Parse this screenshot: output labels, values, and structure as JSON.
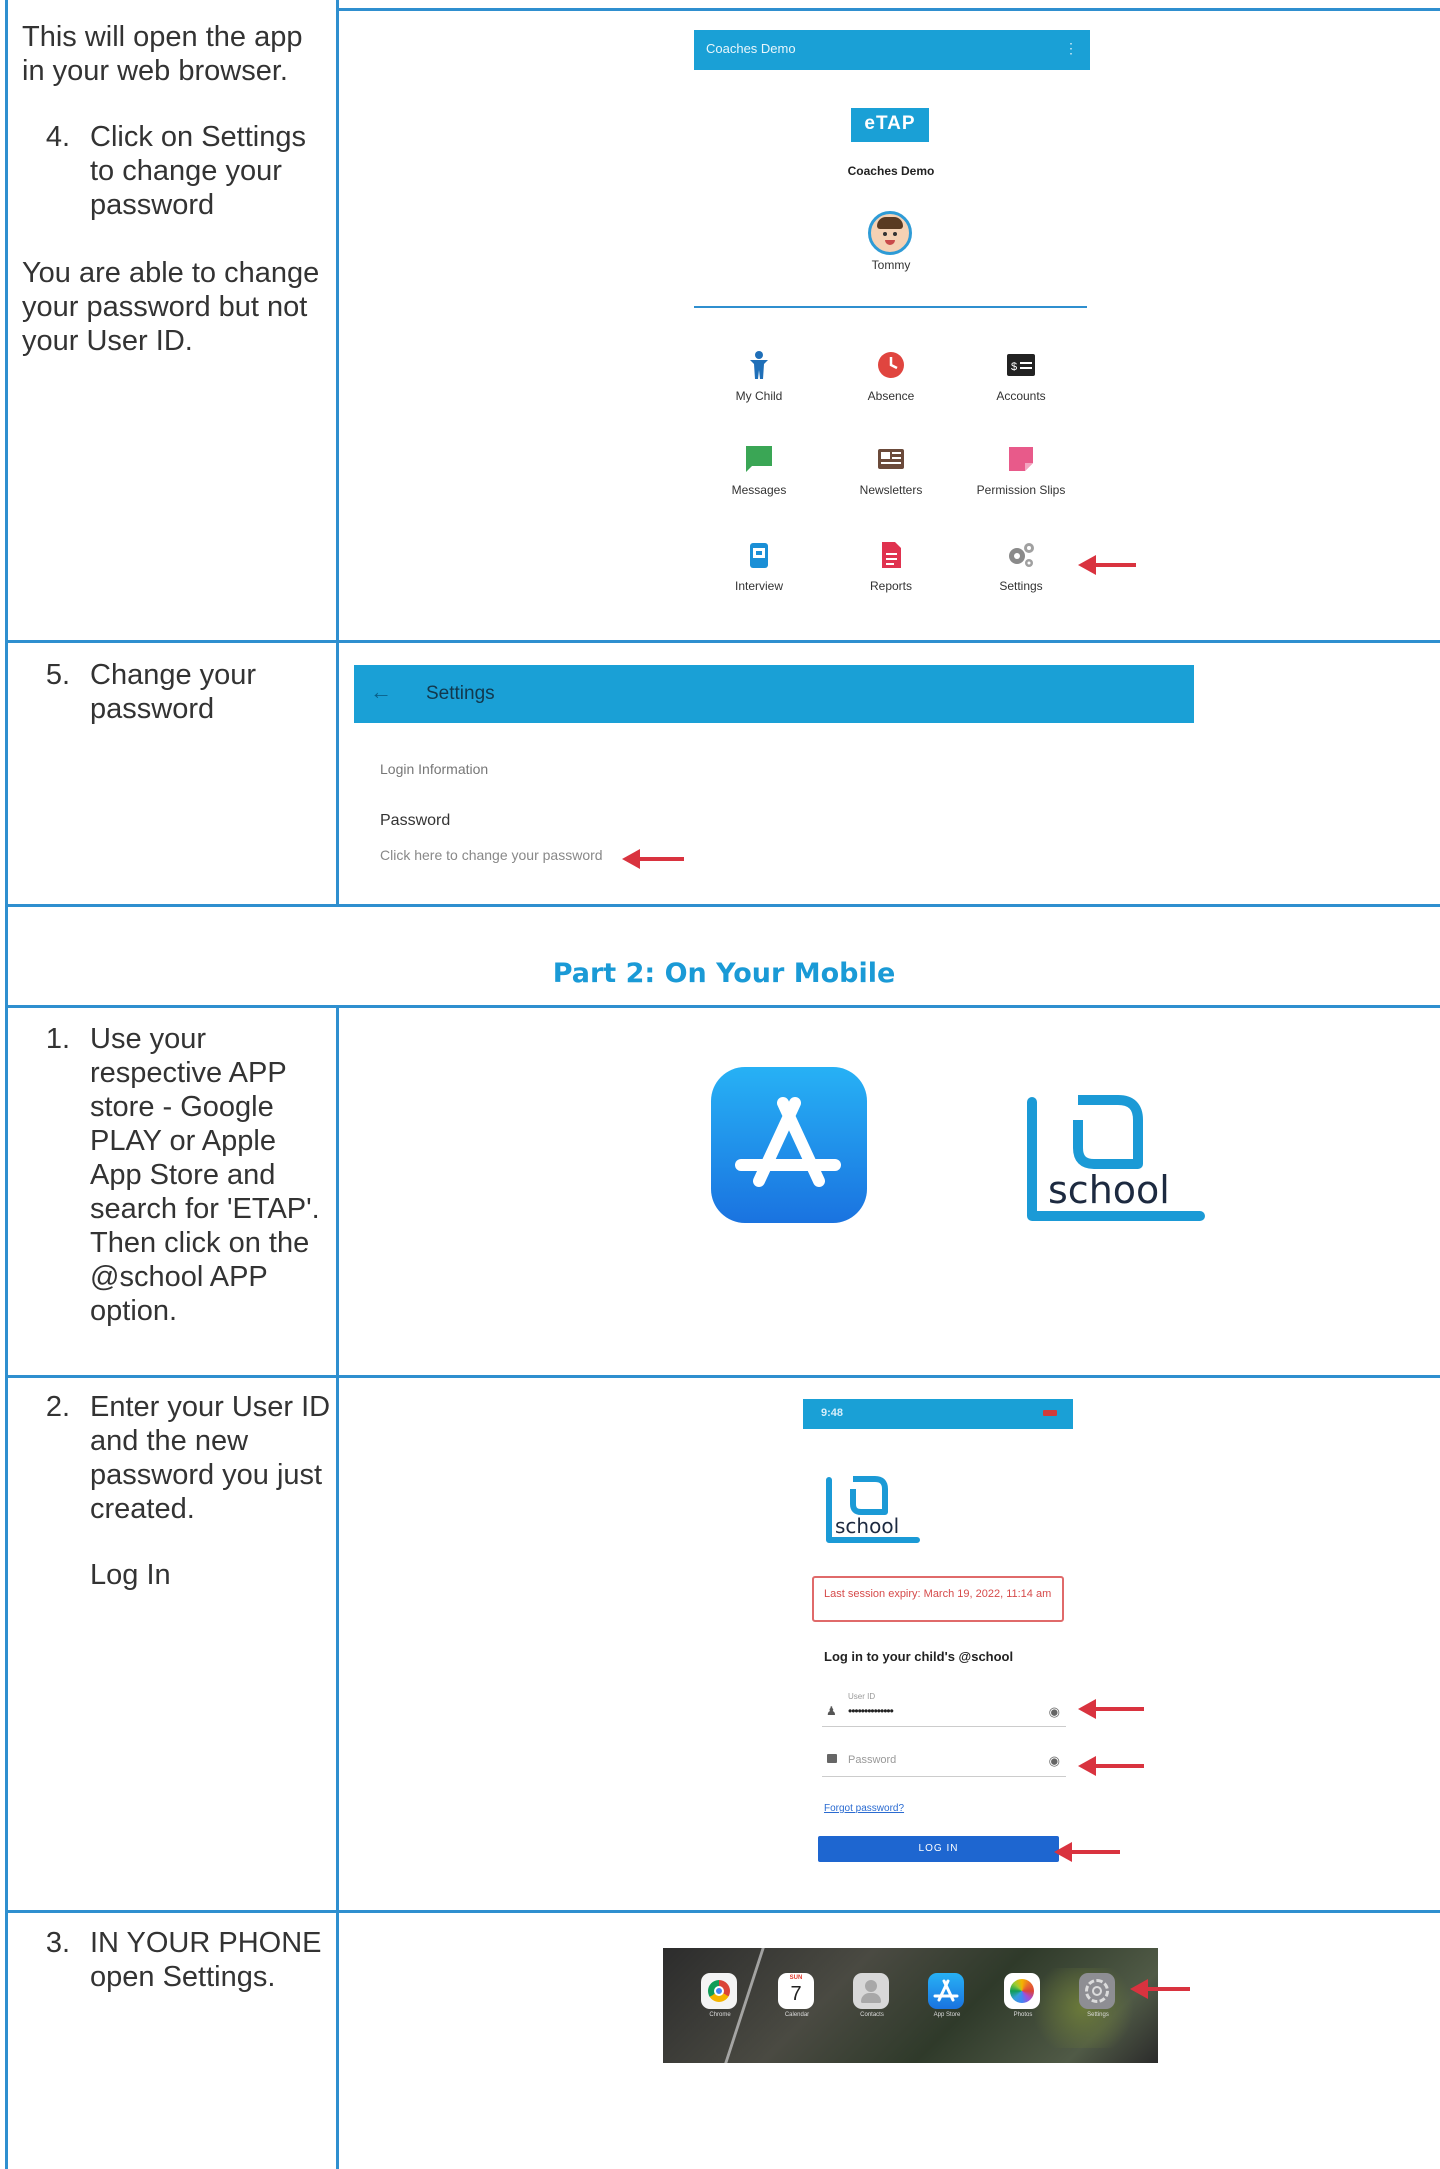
{
  "row1": {
    "intro": "This will open the app in your web browser.",
    "step_number": "4.",
    "step_text": "Click on Settings to change your password",
    "note": "You are able to change your password but not your User ID.",
    "app": {
      "header_title": "Coaches Demo",
      "logo_text": "eTAP",
      "school_name": "Coaches Demo",
      "child_name": "Tommy",
      "tiles": [
        {
          "label": "My Child",
          "icon": "child-icon"
        },
        {
          "label": "Absence",
          "icon": "clock-icon"
        },
        {
          "label": "Accounts",
          "icon": "dollar-card-icon"
        },
        {
          "label": "Messages",
          "icon": "chat-bubble-icon"
        },
        {
          "label": "Newsletters",
          "icon": "newspaper-icon"
        },
        {
          "label": "Permission Slips",
          "icon": "sticky-note-icon"
        },
        {
          "label": "Interview",
          "icon": "calendar-icon"
        },
        {
          "label": "Reports",
          "icon": "document-icon"
        },
        {
          "label": "Settings",
          "icon": "gears-icon"
        }
      ]
    }
  },
  "row2": {
    "step_number": "5.",
    "step_text": "Change your password",
    "settings": {
      "title": "Settings",
      "section": "Login Information",
      "field_label": "Password",
      "field_link": "Click here to change your password"
    }
  },
  "part2": {
    "heading": "Part 2: On Your Mobile"
  },
  "row3": {
    "step_number": "1.",
    "step_text": "Use your respective APP store - Google PLAY or Apple App Store and search for 'ETAP'. Then click on the @school APP option.",
    "school_logo_text": "school"
  },
  "row4": {
    "step_number": "2.",
    "step_text": "Enter your User ID and the new password you just created.",
    "step_sub": "Log In",
    "login": {
      "status_time": "9:48",
      "logo_text": "school",
      "session_notice": "Last session expiry: March 19, 2022, 11:14 am",
      "heading": "Log in to your child's @school",
      "userid_label": "User ID",
      "userid_value": "••••••••••••••",
      "password_placeholder": "Password",
      "forgot_link": "Forgot password?",
      "login_button": "LOG IN"
    }
  },
  "row5": {
    "step_number": "3.",
    "step_text": "IN YOUR PHONE open Settings.",
    "dock": [
      {
        "label": "Chrome",
        "icon": "chrome-icon"
      },
      {
        "label": "Calendar",
        "icon": "calendar-day-icon",
        "day": "SUN",
        "date": "7"
      },
      {
        "label": "Contacts",
        "icon": "contacts-icon"
      },
      {
        "label": "App Store",
        "icon": "app-store-icon"
      },
      {
        "label": "Photos",
        "icon": "photos-icon"
      },
      {
        "label": "Settings",
        "icon": "settings-gear-icon"
      }
    ]
  },
  "colors": {
    "border": "#2f8fcf",
    "accent": "#1aa0d6",
    "arrow": "#d9333f",
    "heading": "#1a9ad6"
  }
}
